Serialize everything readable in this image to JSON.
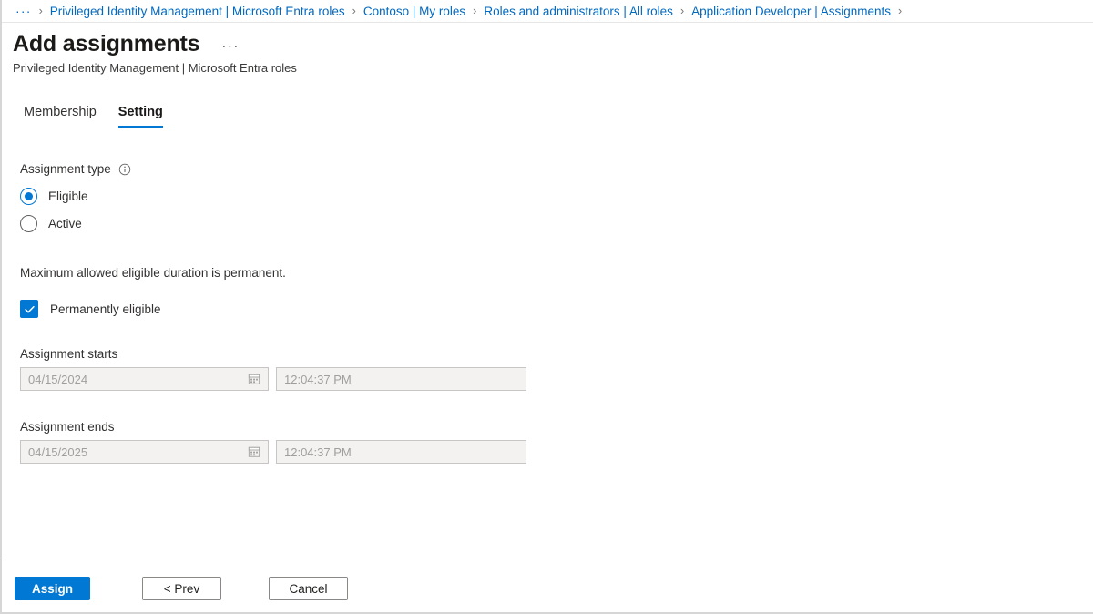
{
  "breadcrumb": {
    "overflow": "···",
    "separator": "›",
    "items": [
      {
        "label": "Privileged Identity Management | Microsoft Entra roles"
      },
      {
        "label": "Contoso | My roles"
      },
      {
        "label": "Roles and administrators | All roles"
      },
      {
        "label": "Application Developer | Assignments"
      }
    ]
  },
  "header": {
    "title": "Add assignments",
    "more_actions": "···",
    "subtitle": "Privileged Identity Management | Microsoft Entra roles"
  },
  "tabs": [
    {
      "label": "Membership",
      "active": false
    },
    {
      "label": "Setting",
      "active": true
    }
  ],
  "form": {
    "assignment_type": {
      "label": "Assignment type",
      "info_tooltip": "info-icon",
      "selected": "Eligible",
      "options": [
        {
          "label": "Eligible",
          "checked": true
        },
        {
          "label": "Active",
          "checked": false
        }
      ]
    },
    "duration_note": "Maximum allowed eligible duration is permanent.",
    "permanently_eligible": {
      "label": "Permanently eligible",
      "checked": true
    },
    "assignment_starts": {
      "label": "Assignment starts",
      "date_value": "04/15/2024",
      "time_value": "12:04:37 PM",
      "disabled": true
    },
    "assignment_ends": {
      "label": "Assignment ends",
      "date_value": "04/15/2025",
      "time_value": "12:04:37 PM",
      "disabled": true
    }
  },
  "footer": {
    "assign_label": "Assign",
    "prev_label": "< Prev",
    "cancel_label": "Cancel"
  },
  "colors": {
    "accent": "#0078d4",
    "link": "#0069c0",
    "text": "#323130",
    "disabled_text": "#a19f9d",
    "disabled_bg": "#f3f2f1",
    "border": "#c8c6c4"
  }
}
